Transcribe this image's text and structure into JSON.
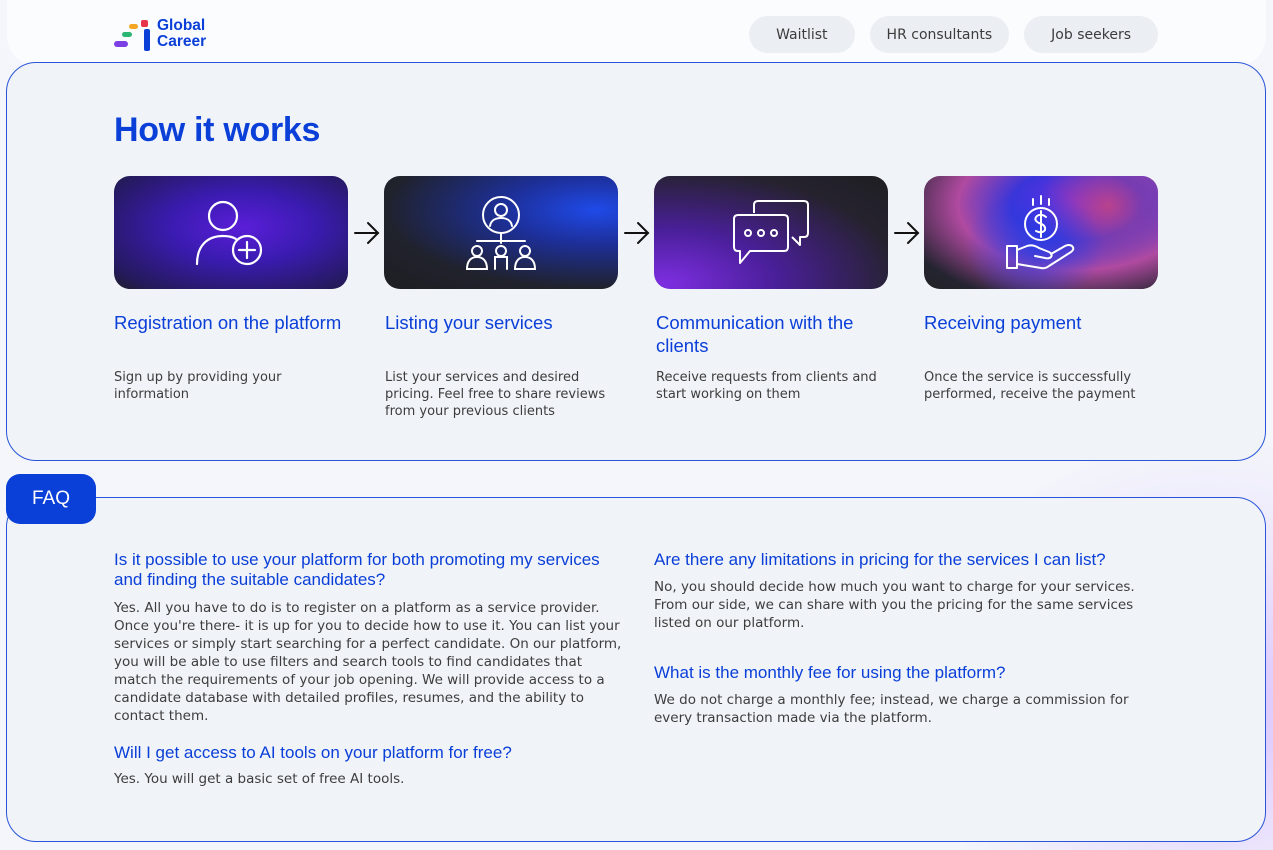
{
  "brand": {
    "name_line1": "Global",
    "name_line2": "Career",
    "colors": {
      "primary": "#0a3fd8",
      "red": "#e8344a",
      "green": "#2bb673",
      "purple": "#7b3fe4",
      "orange": "#f5a623"
    }
  },
  "nav": {
    "items": [
      {
        "label": "Waitlist"
      },
      {
        "label": "HR consultants"
      },
      {
        "label": "Job seekers"
      }
    ]
  },
  "how_it_works": {
    "title": "How it works",
    "steps": [
      {
        "icon": "user-add-icon",
        "title": "Registration on the platform",
        "description": "Sign up by providing your information"
      },
      {
        "icon": "team-network-icon",
        "title": "Listing your services",
        "description": "List your services and desired pricing. Feel free to share reviews from your previous clients"
      },
      {
        "icon": "chat-bubbles-icon",
        "title": "Communication with the clients",
        "description": "Receive requests from clients and start working on them"
      },
      {
        "icon": "payment-hand-icon",
        "title": "Receiving payment",
        "description": "Once the service is successfully performed, receive the payment"
      }
    ]
  },
  "faq": {
    "tab_label": "FAQ",
    "items": [
      {
        "question": "Is it possible to use your platform for both promoting my services and finding the suitable candidates?",
        "answer": "Yes. All you have to do is to register on a platform as a service provider. Once you're there- it is up for you to decide how to use it. You can list your services or simply start searching for a perfect candidate. On our platform, you will be able to use filters and search tools to find candidates that match the requirements of your job opening. We will provide access to a candidate database with detailed profiles, resumes, and the ability to contact them."
      },
      {
        "question": "Will I get access to AI tools on your platform for free?",
        "answer": "Yes. You will get a basic set of free AI tools."
      },
      {
        "question": "Are there any limitations in pricing for the services I can list?",
        "answer": "No, you should decide how much you want to charge for your services. From our side, we can share with you the pricing for the same services listed on our platform."
      },
      {
        "question": "What is the monthly fee for using the platform?",
        "answer": "We do not charge a monthly fee; instead, we charge a commission for every transaction made via the platform."
      }
    ]
  }
}
